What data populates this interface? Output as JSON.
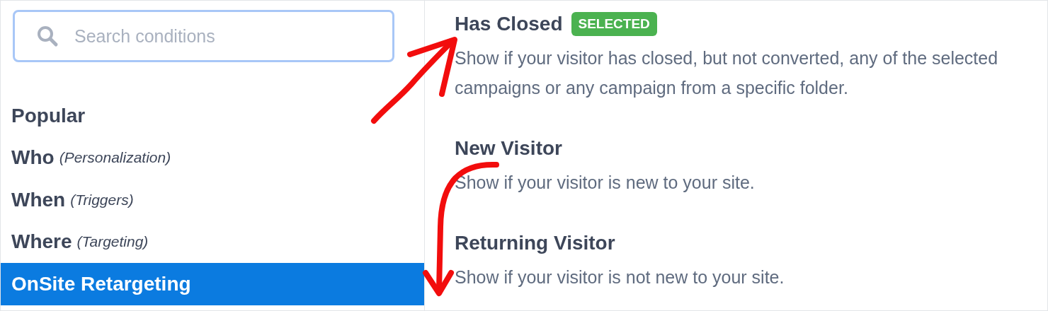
{
  "search": {
    "placeholder": "Search conditions"
  },
  "sidebar": {
    "items": [
      {
        "label": "Popular",
        "selected": false
      },
      {
        "label": "Who",
        "note": "(Personalization)",
        "selected": false
      },
      {
        "label": "When",
        "note": "(Triggers)",
        "selected": false
      },
      {
        "label": "Where",
        "note": "(Targeting)",
        "selected": false
      },
      {
        "label": "OnSite Retargeting",
        "selected": true
      }
    ]
  },
  "conditions": [
    {
      "title": "Has Closed",
      "badge": "SELECTED",
      "description": "Show if your visitor has closed, but not converted, any of the selected campaigns or any campaign from a specific folder."
    },
    {
      "title": "New Visitor",
      "description": "Show if your visitor is new to your site."
    },
    {
      "title": "Returning Visitor",
      "description": "Show if your visitor is not new to your site."
    }
  ]
}
